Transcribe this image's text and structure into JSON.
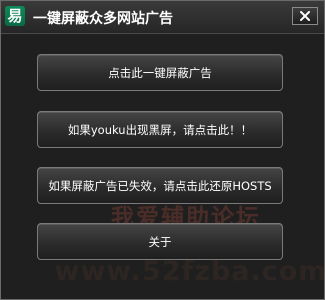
{
  "window": {
    "title": "一键屏蔽众多网站广告",
    "app_icon_glyph": "易",
    "app_icon_name": "app-logo-icon",
    "close_icon_name": "close-icon"
  },
  "buttons": {
    "block_ads": "点击此一键屏蔽广告",
    "youku_black_screen": "如果youku出现黑屏，请点击此！！",
    "restore_hosts": "如果屏蔽广告已失效，请点击此还原HOSTS",
    "about": "关于"
  },
  "watermark": {
    "line1": "我爱辅助论坛",
    "line2": "www.52fzba.com"
  },
  "colors": {
    "accent_icon": "#0e8a5a",
    "window_background": "#1f1f1f",
    "button_border": "#7a7a7a",
    "text": "#ffffff"
  }
}
